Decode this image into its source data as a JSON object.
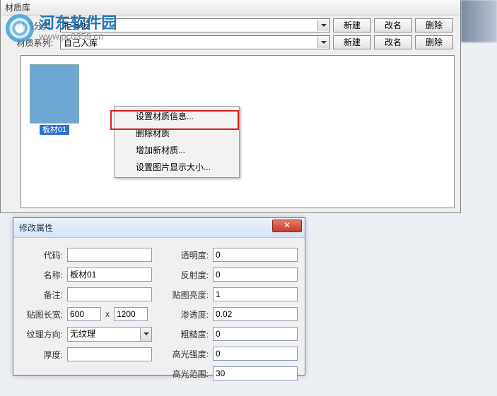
{
  "watermark": {
    "title": "河东软件园",
    "url": "www.pc0359.cn"
  },
  "panel": {
    "title": "材质库",
    "row1_label": "材质分类:",
    "row2_label": "材质系列:",
    "category_value": "柜身板",
    "series_value": "自己入库",
    "btn_new": "新建",
    "btn_rename": "改名",
    "btn_delete": "删除"
  },
  "swatch": {
    "label": "板材01"
  },
  "menu": {
    "item1": "设置材质信息...",
    "item2": "删除材质",
    "item3": "增加新材质...",
    "item4": "设置图片显示大小..."
  },
  "dialog": {
    "title": "修改属性",
    "code_label": "代码:",
    "code_value": "",
    "name_label": "名称:",
    "name_value": "板材01",
    "remark_label": "备注:",
    "remark_value": "",
    "mapsize_label": "贴图长宽:",
    "map_w": "600",
    "map_x": "x",
    "map_h": "1200",
    "texdir_label": "纹理方向:",
    "texdir_value": "无纹理",
    "thick_label": "厚度:",
    "thick_value": "",
    "opacity_label": "透明度:",
    "opacity_value": "0",
    "reflect_label": "反射度:",
    "reflect_value": "0",
    "mapbright_label": "贴图亮度:",
    "mapbright_value": "1",
    "permeate_label": "渗透度:",
    "permeate_value": "0.02",
    "rough_label": "粗糙度:",
    "rough_value": "0",
    "specstr_label": "高光强度:",
    "specstr_value": "0",
    "specrange_label": "高光范围:",
    "specrange_value": "30"
  }
}
